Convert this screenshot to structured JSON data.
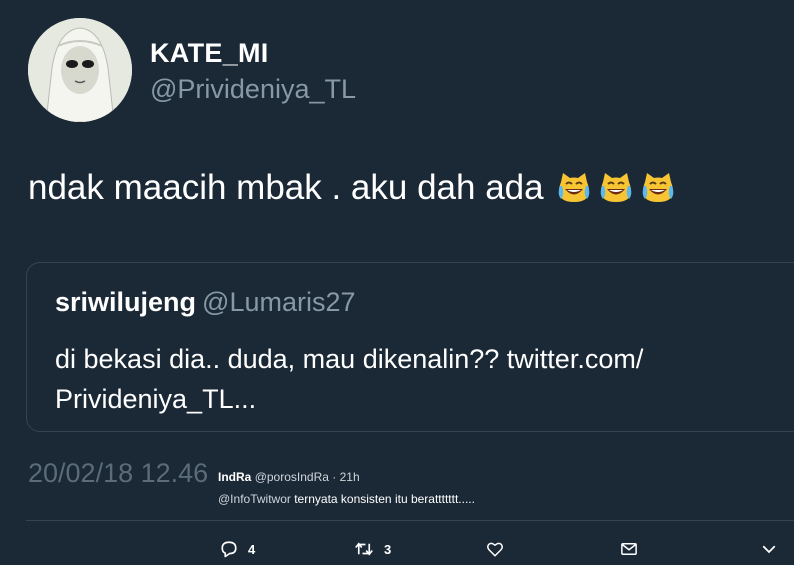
{
  "author": {
    "display_name": "KATE_MI",
    "handle": "@Privideniya_TL",
    "avatar_icon": "avatar-photo"
  },
  "tweet": {
    "text": "ndak maacih mbak . aku dah ada",
    "emojis": [
      "tears-of-joy-cat-emoji",
      "tears-of-joy-cat-emoji",
      "tears-of-joy-cat-emoji"
    ]
  },
  "quote": {
    "name": "sriwilujeng",
    "handle": "@Lumaris27",
    "text_line1": "di bekasi dia.. duda, mau dikenalin?? twitter.com/",
    "text_line2": "Privideniya_TL..."
  },
  "timestamp": "20/02/18 12.46",
  "overlay_reply": {
    "name": "IndRa",
    "handle": "@porosIndRa",
    "time": "· 21h",
    "mention": "@InfoTwitwor",
    "text": "ternyata konsisten itu berattttttt....."
  },
  "actions": {
    "reply_count": "4",
    "retweet_count": "3"
  },
  "colors": {
    "background": "#1b2836",
    "muted_text": "#8899a6",
    "border": "#38444d"
  }
}
